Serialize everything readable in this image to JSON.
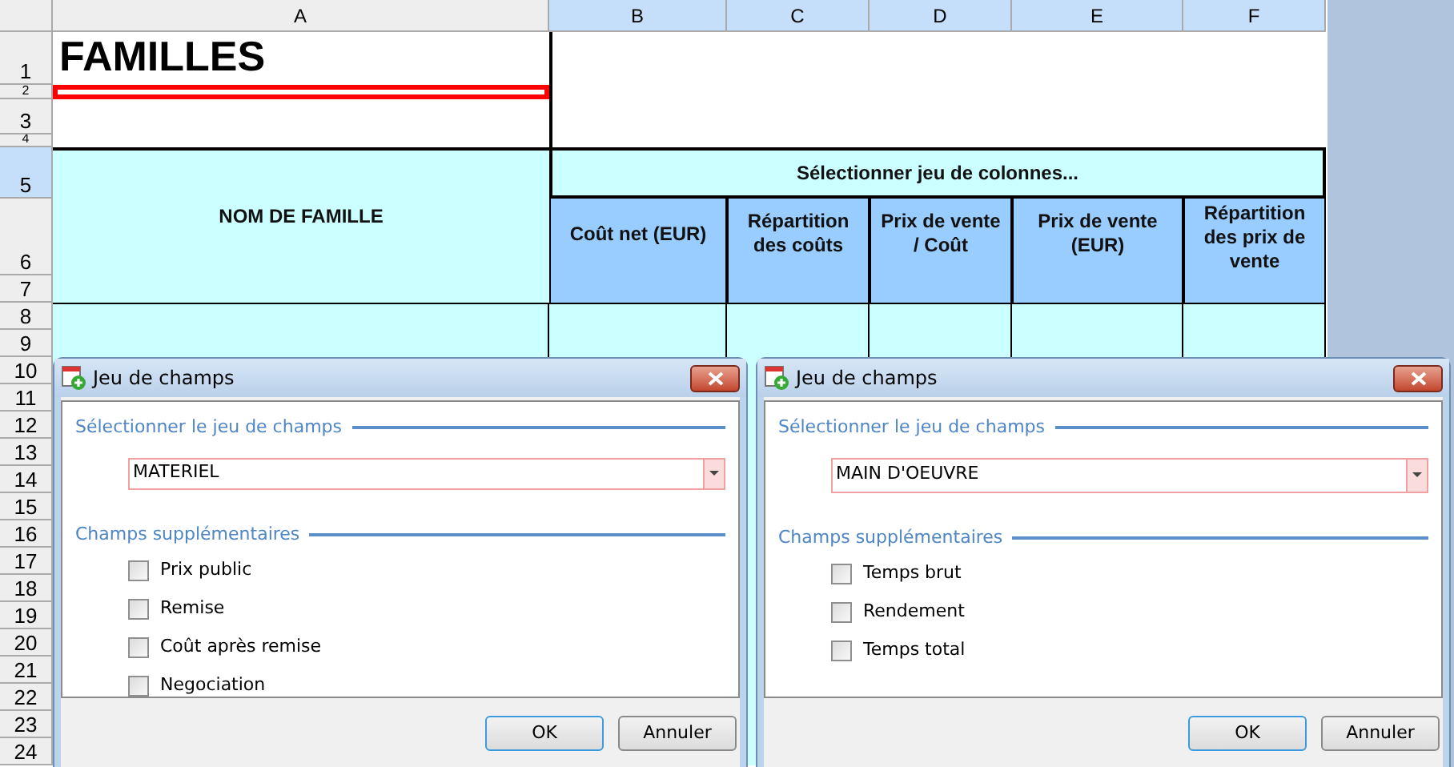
{
  "sheet": {
    "column_headers": [
      {
        "label": "A",
        "selected": false
      },
      {
        "label": "B",
        "selected": true
      },
      {
        "label": "C",
        "selected": true
      },
      {
        "label": "D",
        "selected": true
      },
      {
        "label": "E",
        "selected": true
      },
      {
        "label": "F",
        "selected": true
      }
    ],
    "row_headers": [
      {
        "label": "1",
        "selected": false
      },
      {
        "label": "2",
        "selected": false
      },
      {
        "label": "3",
        "selected": false
      },
      {
        "label": "4",
        "selected": false
      },
      {
        "label": "5",
        "selected": true
      },
      {
        "label": "6",
        "selected": false
      },
      {
        "label": "7",
        "selected": false
      },
      {
        "label": "8",
        "selected": false
      },
      {
        "label": "9",
        "selected": false
      },
      {
        "label": "10",
        "selected": false
      },
      {
        "label": "11",
        "selected": false
      },
      {
        "label": "12",
        "selected": false
      },
      {
        "label": "13",
        "selected": false
      },
      {
        "label": "14",
        "selected": false
      },
      {
        "label": "15",
        "selected": false
      },
      {
        "label": "16",
        "selected": false
      },
      {
        "label": "17",
        "selected": false
      },
      {
        "label": "18",
        "selected": false
      },
      {
        "label": "19",
        "selected": false
      },
      {
        "label": "20",
        "selected": false
      },
      {
        "label": "21",
        "selected": false
      },
      {
        "label": "22",
        "selected": false
      },
      {
        "label": "23",
        "selected": false
      },
      {
        "label": "24",
        "selected": false
      }
    ],
    "title": "FAMILLES",
    "name_header": "NOM DE FAMILLE",
    "group_header": "Sélectionner jeu de colonnes...",
    "columns": [
      "Coût net (EUR)",
      "Répartition des coûts",
      "Prix de vente / Coût",
      "Prix de vente (EUR)",
      "Répartition des prix de vente"
    ]
  },
  "dialogs": [
    {
      "title": "Jeu de champs",
      "select_section": "Sélectionner le jeu de champs",
      "value": "MATERIEL",
      "extra_section": "Champs supplémentaires",
      "checkboxes": [
        {
          "label": "Prix public",
          "checked": false
        },
        {
          "label": "Remise",
          "checked": false
        },
        {
          "label": "Coût après remise",
          "checked": false
        },
        {
          "label": "Negociation",
          "checked": false
        }
      ],
      "buttons": [
        "OK",
        "Annuler"
      ]
    },
    {
      "title": "Jeu de champs",
      "select_section": "Sélectionner le jeu de champs",
      "value": "MAIN D'OEUVRE",
      "extra_section": "Champs supplémentaires",
      "checkboxes": [
        {
          "label": "Temps brut",
          "checked": false
        },
        {
          "label": "Rendement",
          "checked": false
        },
        {
          "label": "Temps total",
          "checked": false
        }
      ],
      "buttons": [
        "OK",
        "Annuler"
      ]
    }
  ]
}
